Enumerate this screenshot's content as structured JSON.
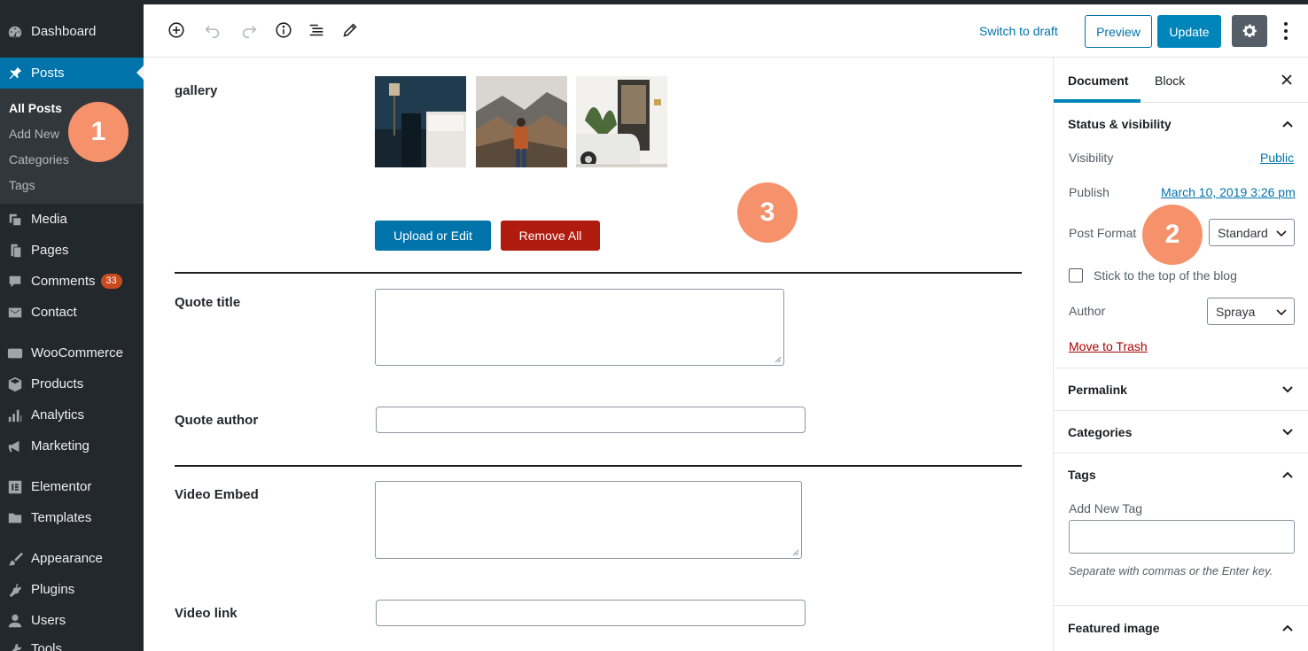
{
  "admin_menu": {
    "dashboard": "Dashboard",
    "posts": "Posts",
    "posts_submenu": [
      "All Posts",
      "Add New",
      "Categories",
      "Tags"
    ],
    "media": "Media",
    "pages": "Pages",
    "comments": "Comments",
    "comments_count": "33",
    "contact": "Contact",
    "woocommerce": "WooCommerce",
    "products": "Products",
    "analytics": "Analytics",
    "marketing": "Marketing",
    "elementor": "Elementor",
    "templates": "Templates",
    "appearance": "Appearance",
    "plugins": "Plugins",
    "users": "Users",
    "tools": "Tools"
  },
  "toolbar": {
    "switch_to_draft": "Switch to draft",
    "preview": "Preview",
    "update": "Update",
    "icons": [
      "add-block-icon",
      "undo-icon",
      "redo-icon",
      "info-icon",
      "outline-icon",
      "edit-icon",
      "gear-icon",
      "more-vertical-icon"
    ]
  },
  "content": {
    "gallery_label": "gallery",
    "upload_button": "Upload or Edit",
    "remove_button": "Remove All",
    "quote_title_label": "Quote title",
    "quote_author_label": "Quote author",
    "video_embed_label": "Video Embed",
    "video_link_label": "Video link"
  },
  "markers": [
    "1",
    "2",
    "3"
  ],
  "settings": {
    "tab_document": "Document",
    "tab_block": "Block",
    "status_visibility": "Status & visibility",
    "visibility_label": "Visibility",
    "visibility_value": "Public",
    "publish_label": "Publish",
    "publish_value": "March 10, 2019 3:26 pm",
    "post_format_label": "Post Format",
    "post_format_value": "Standard",
    "sticky_label": "Stick to the top of the blog",
    "author_label": "Author",
    "author_value": "Spraya",
    "move_to_trash": "Move to Trash",
    "permalink": "Permalink",
    "categories": "Categories",
    "tags": "Tags",
    "add_new_tag": "Add New Tag",
    "tag_help": "Separate with commas or the Enter key.",
    "featured_image": "Featured image"
  },
  "colors": {
    "admin_bg": "#23282d",
    "accent": "#0073aa",
    "danger": "#b01b0f",
    "marker": "#f5916b"
  }
}
